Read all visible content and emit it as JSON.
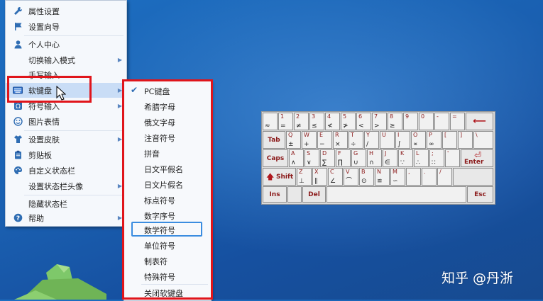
{
  "menu": {
    "items": [
      {
        "label": "属性设置",
        "icon": "wrench-icon",
        "arrow": false
      },
      {
        "label": "设置向导",
        "icon": "flag-icon",
        "arrow": false
      },
      {
        "label": "个人中心",
        "icon": "user-icon",
        "arrow": false
      },
      {
        "label": "切换输入模式",
        "icon": "",
        "arrow": true
      },
      {
        "label": "手写输入",
        "icon": "",
        "arrow": false
      },
      {
        "label": "软键盘",
        "icon": "keyboard-icon",
        "arrow": true
      },
      {
        "label": "符号输入",
        "icon": "symbol-icon",
        "arrow": true
      },
      {
        "label": "图片表情",
        "icon": "smiley-icon",
        "arrow": false
      },
      {
        "label": "设置皮肤",
        "icon": "shirt-icon",
        "arrow": true
      },
      {
        "label": "剪贴板",
        "icon": "clipboard-icon",
        "arrow": false
      },
      {
        "label": "自定义状态栏",
        "icon": "palette-icon",
        "arrow": false
      },
      {
        "label": "设置状态栏头像",
        "icon": "",
        "arrow": true
      },
      {
        "label": "隐藏状态栏",
        "icon": "",
        "arrow": false
      },
      {
        "label": "帮助",
        "icon": "help-icon",
        "arrow": true
      }
    ]
  },
  "submenu": {
    "items": [
      {
        "label": "PC键盘",
        "checked": true
      },
      {
        "label": "希腊字母",
        "checked": false
      },
      {
        "label": "俄文字母",
        "checked": false
      },
      {
        "label": "注音符号",
        "checked": false
      },
      {
        "label": "拼音",
        "checked": false
      },
      {
        "label": "日文平假名",
        "checked": false
      },
      {
        "label": "日文片假名",
        "checked": false
      },
      {
        "label": "标点符号",
        "checked": false
      },
      {
        "label": "数字序号",
        "checked": false
      },
      {
        "label": "数学符号",
        "checked": false
      },
      {
        "label": "单位符号",
        "checked": false
      },
      {
        "label": "制表符",
        "checked": false
      },
      {
        "label": "特殊符号",
        "checked": false
      },
      {
        "label": "关闭软键盘",
        "checked": false
      }
    ],
    "check_glyph": "✔"
  },
  "keyboard": {
    "row1": [
      {
        "t": "",
        "b": "≈"
      },
      {
        "t": "1",
        "b": "="
      },
      {
        "t": "2",
        "b": "≠"
      },
      {
        "t": "3",
        "b": "≤"
      },
      {
        "t": "4",
        "b": "≮"
      },
      {
        "t": "5",
        "b": "≯"
      },
      {
        "t": "6",
        "b": "<"
      },
      {
        "t": "7",
        "b": ">"
      },
      {
        "t": "8",
        "b": "≥"
      },
      {
        "t": "9",
        "b": ""
      },
      {
        "t": "0",
        "b": ""
      },
      {
        "t": "-",
        "b": ""
      },
      {
        "t": "=",
        "b": ""
      }
    ],
    "row2": [
      {
        "t": "Q",
        "b": "±"
      },
      {
        "t": "W",
        "b": "+"
      },
      {
        "t": "E",
        "b": "−"
      },
      {
        "t": "R",
        "b": "×"
      },
      {
        "t": "T",
        "b": "÷"
      },
      {
        "t": "Y",
        "b": "/"
      },
      {
        "t": "U",
        "b": ""
      },
      {
        "t": "I",
        "b": "∫"
      },
      {
        "t": "O",
        "b": "∝"
      },
      {
        "t": "P",
        "b": "∞"
      },
      {
        "t": "[",
        "b": ""
      },
      {
        "t": "]",
        "b": ""
      },
      {
        "t": "\\",
        "b": ""
      }
    ],
    "row3": [
      {
        "t": "A",
        "b": "∧"
      },
      {
        "t": "S",
        "b": "∨"
      },
      {
        "t": "D",
        "b": "∑"
      },
      {
        "t": "F",
        "b": "∏"
      },
      {
        "t": "G",
        "b": "∪"
      },
      {
        "t": "H",
        "b": "∩"
      },
      {
        "t": "J",
        "b": "∈"
      },
      {
        "t": "K",
        "b": "∵"
      },
      {
        "t": "L",
        "b": "∴"
      },
      {
        "t": ";",
        "b": "∷"
      },
      {
        "t": "'",
        "b": ""
      }
    ],
    "row4": [
      {
        "t": "Z",
        "b": "⊥"
      },
      {
        "t": "X",
        "b": "∥"
      },
      {
        "t": "C",
        "b": "∠"
      },
      {
        "t": "V",
        "b": "⌒"
      },
      {
        "t": "B",
        "b": "⊙"
      },
      {
        "t": "N",
        "b": "≌"
      },
      {
        "t": "M",
        "b": "∽"
      },
      {
        "t": ",",
        "b": ""
      },
      {
        "t": ".",
        "b": ""
      },
      {
        "t": "/",
        "b": ""
      }
    ],
    "tab": "Tab",
    "caps": "Caps",
    "shift": "Shift",
    "enter": "Enter",
    "backspace_glyph": "⟵",
    "ins": "Ins",
    "del": "Del",
    "esc": "Esc"
  },
  "watermark": "知乎 @丹浙"
}
